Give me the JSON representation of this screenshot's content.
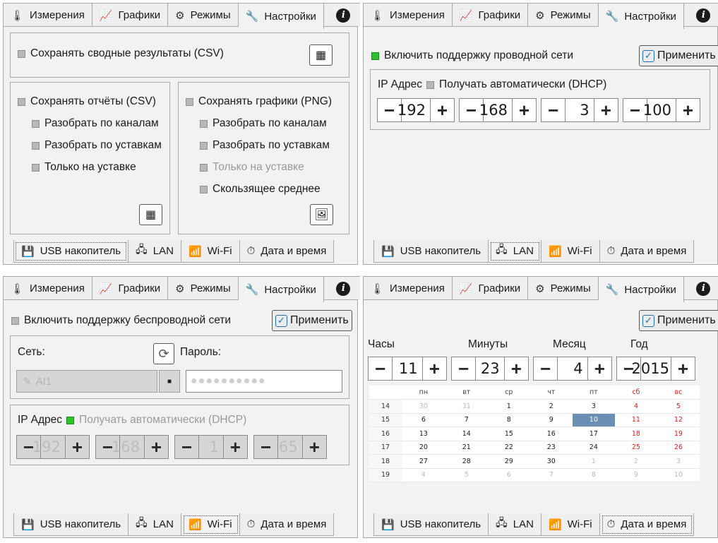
{
  "top_tabs": [
    {
      "icon": "thermometer-icon",
      "glyph": "🌡",
      "label": "Измерения"
    },
    {
      "icon": "chart-icon",
      "glyph": "📈",
      "label": "Графики"
    },
    {
      "icon": "gear-icon",
      "glyph": "⚙",
      "label": "Режимы"
    },
    {
      "icon": "wrench-icon",
      "glyph": "🔧",
      "label": "Настройки"
    },
    {
      "icon": "info-icon",
      "glyph": "i",
      "label": ""
    }
  ],
  "bottom_tabs": [
    {
      "icon": "usb-drive-icon",
      "glyph": "💾",
      "label": "USB накопитель"
    },
    {
      "icon": "network-icon",
      "glyph": "🖧",
      "label": "LAN"
    },
    {
      "icon": "wifi-icon",
      "glyph": "📶",
      "label": "Wi-Fi"
    },
    {
      "icon": "clock-icon",
      "glyph": "⏱",
      "label": "Дата и время"
    }
  ],
  "usb": {
    "summary_label": "Сохранять сводные результаты (CSV)",
    "reports_label": "Сохранять отчёты (CSV)",
    "reports_options": [
      "Разобрать по каналам",
      "Разобрать по уставкам",
      "Только на уставке"
    ],
    "graphs_label": "Сохранять графики (PNG)",
    "graphs_options": [
      "Разобрать по каналам",
      "Разобрать по уставкам",
      "Только на уставке",
      "Скользящее среднее"
    ]
  },
  "lan": {
    "enable_label": "Включить поддержку проводной сети",
    "apply_label": "Применить",
    "ip_label": "IP Адрес",
    "dhcp_label": "Получать автоматически (DHCP)",
    "ip": [
      "192",
      "168",
      "3",
      "100"
    ]
  },
  "wifi": {
    "enable_label": "Включить поддержку беспроводной сети",
    "apply_label": "Применить",
    "network_label": "Сеть:",
    "password_label": "Пароль:",
    "network_value": "AI1",
    "password_value": "●●●●●●●●●●",
    "ip_label": "IP Адрес",
    "dhcp_label": "Получать автоматически (DHCP)",
    "ip": [
      "192",
      "168",
      "1",
      "65"
    ]
  },
  "datetime": {
    "apply_label": "Применить",
    "hours_label": "Часы",
    "minutes_label": "Минуты",
    "month_label": "Месяц",
    "year_label": "Год",
    "hours": "11",
    "minutes": "23",
    "month": "4",
    "year": "2015",
    "weekdays": [
      "пн",
      "вт",
      "ср",
      "чт",
      "пт",
      "сб",
      "вс"
    ],
    "weeks": [
      {
        "num": "14",
        "days": [
          "30",
          "31",
          "1",
          "2",
          "3",
          "4",
          "5"
        ]
      },
      {
        "num": "15",
        "days": [
          "6",
          "7",
          "8",
          "9",
          "10",
          "11",
          "12"
        ]
      },
      {
        "num": "16",
        "days": [
          "13",
          "14",
          "15",
          "16",
          "17",
          "18",
          "19"
        ]
      },
      {
        "num": "17",
        "days": [
          "20",
          "21",
          "22",
          "23",
          "24",
          "25",
          "26"
        ]
      },
      {
        "num": "18",
        "days": [
          "27",
          "28",
          "29",
          "30",
          "1",
          "2",
          "3"
        ]
      },
      {
        "num": "19",
        "days": [
          "4",
          "5",
          "6",
          "7",
          "8",
          "9",
          "10"
        ]
      }
    ],
    "selected_day": "10"
  }
}
